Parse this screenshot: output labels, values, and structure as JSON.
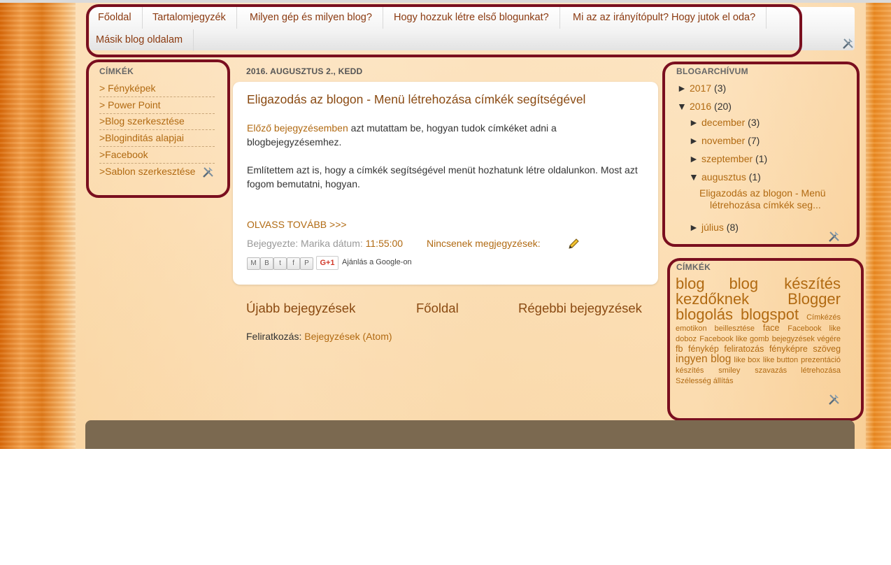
{
  "nav": {
    "items": [
      "Főoldal",
      "Tartalomjegyzék",
      "Milyen gép és milyen blog?",
      "Hogy hozzuk létre első blogunkat?",
      "Mi az az irányítópult? Hogy jutok el oda?",
      "Másik blog oldalam"
    ]
  },
  "labels_widget": {
    "title": "CÍMKÉK",
    "items": [
      "> Fényképek",
      "> Power Point",
      ">Blog szerkesztése",
      ">Bloginditás alapjai",
      ">Facebook",
      ">Sablon szerkesztése"
    ]
  },
  "post": {
    "date": "2016. AUGUSZTUS 2., KEDD",
    "title": "Eligazodás az blogon - Menü létrehozása címkék segítségével",
    "p1_link": "Előző bejegyzésemben",
    "p1_rest": " azt mutattam be, hogyan tudok címkéket adni a blogbejegyzésemhez.",
    "p2": "Említettem azt is, hogy a címkék segítségével menüt hozhatunk létre oldalunkon. Most azt fogom bemutatni, hogyan.",
    "read_more": "OLVASS TOVÁBB >>>",
    "meta_prefix": "Bejegyezte: Marika dátum: ",
    "time": "11:55:00",
    "comments": "Nincsenek megjegyzések:",
    "share_icons": [
      "email-icon",
      "blogger-icon",
      "twitter-icon",
      "facebook-icon",
      "pinterest-icon"
    ],
    "gplus_label": "G+1",
    "gplus_text": "Ajánlás a Google-on"
  },
  "pager": {
    "newer": "Újabb bejegyzések",
    "home": "Főoldal",
    "older": "Régebbi bejegyzések"
  },
  "subscribe": {
    "label": "Feliratkozás: ",
    "link": "Bejegyzések (Atom)"
  },
  "archive": {
    "title": "BLOGARCHÍVUM",
    "y2017": {
      "toggle": "►",
      "label": "2017",
      "count": "(3)"
    },
    "y2016": {
      "toggle": "▼",
      "label": "2016",
      "count": "(20)"
    },
    "dec": {
      "toggle": "►",
      "label": "december",
      "count": "(3)"
    },
    "nov": {
      "toggle": "►",
      "label": "november",
      "count": "(7)"
    },
    "sep": {
      "toggle": "►",
      "label": "szeptember",
      "count": "(1)"
    },
    "aug": {
      "toggle": "▼",
      "label": "augusztus",
      "count": "(1)"
    },
    "post_line1": "Eligazodás az blogon - Menü",
    "post_line2": "létrehozása címkék seg...",
    "jul": {
      "toggle": "►",
      "label": "július",
      "count": "(8)"
    }
  },
  "tags": {
    "title": "CÍMKÉK",
    "items": [
      {
        "text": "blog",
        "size": 5
      },
      {
        "text": "blog készítés kezdőknek",
        "size": 5
      },
      {
        "text": "Blogger",
        "size": 5
      },
      {
        "text": "blogolás",
        "size": 5
      },
      {
        "text": "blogspot",
        "size": 5
      },
      {
        "text": "Címkézés",
        "size": 1
      },
      {
        "text": "emotikon beillesztése",
        "size": 1
      },
      {
        "text": "face",
        "size": 2
      },
      {
        "text": "Facebook like doboz",
        "size": 1
      },
      {
        "text": "Facebook like gomb",
        "size": 1
      },
      {
        "text": "bejegyzések végére",
        "size": 1
      },
      {
        "text": "fb",
        "size": 2
      },
      {
        "text": "fénykép",
        "size": 2
      },
      {
        "text": "feliratozás",
        "size": 2
      },
      {
        "text": "fényképre",
        "size": 2
      },
      {
        "text": "szöveg",
        "size": 2
      },
      {
        "text": "ingyen blog",
        "size": 3
      },
      {
        "text": "like box",
        "size": 1
      },
      {
        "text": "like button",
        "size": 1
      },
      {
        "text": "prezentáció készítés",
        "size": 1
      },
      {
        "text": "smiley",
        "size": 1
      },
      {
        "text": "szavazás létrehozása",
        "size": 1
      },
      {
        "text": "Szélesség állítás",
        "size": 1
      }
    ]
  },
  "colors": {
    "link": "#b16a12",
    "title": "#8a4a12",
    "highlight_box": "#7a0f1f",
    "footer": "#7b6950"
  }
}
